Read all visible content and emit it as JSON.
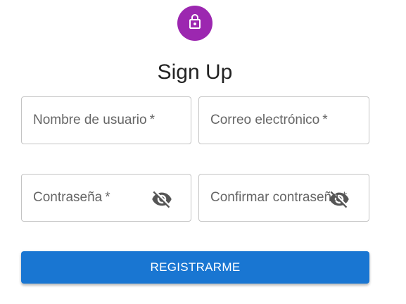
{
  "header": {
    "icon": "lock-icon",
    "icon_bg_color": "#9c27b0",
    "title": "Sign Up"
  },
  "form": {
    "username_label": "Nombre de usuario",
    "email_label": "Correo electrónico",
    "password_label": "Contraseña",
    "confirm_label": "Confirmar contraseña",
    "required_marker": "*",
    "visibility_icon": "visibility-off-icon"
  },
  "actions": {
    "submit_label": "REGISTRARME",
    "submit_color": "#1976d2"
  }
}
